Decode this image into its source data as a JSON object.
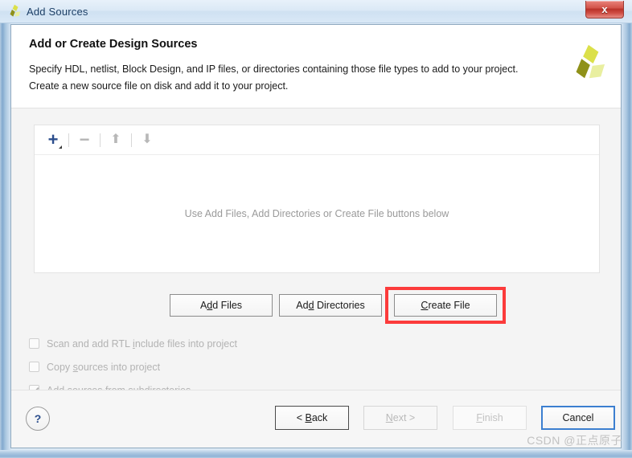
{
  "window": {
    "title": "Add Sources",
    "app_icon": "xilinx-logo-icon",
    "close_label": "x"
  },
  "header": {
    "title": "Add or Create Design Sources",
    "line1": "Specify HDL, netlist, Block Design, and IP files, or directories containing those file types to add to your project.",
    "line2": "Create a new source file on disk and add it to your project.",
    "logo": "xilinx-logo-icon"
  },
  "list_panel": {
    "toolbar": {
      "add_icon": "plus-icon",
      "remove_icon": "minus-icon",
      "move_up_icon": "arrow-up-icon",
      "move_down_icon": "arrow-down-icon",
      "add_glyph": "+",
      "remove_glyph": "−",
      "up_glyph": "⬆",
      "down_glyph": "⬇"
    },
    "empty_message": "Use Add Files, Add Directories or Create File buttons below"
  },
  "actions": {
    "add_files": {
      "pre": "A",
      "mnemonic": "d",
      "post": "d Files"
    },
    "add_directories": {
      "pre": "Ad",
      "mnemonic": "d",
      "post": " Directories"
    },
    "create_file": {
      "pre": "",
      "mnemonic": "C",
      "post": "reate File"
    },
    "highlight_color": "#fc3b3b",
    "highlighted": "create_file"
  },
  "options": [
    {
      "pre": "Scan and add RTL ",
      "mnemonic": "i",
      "post": "nclude files into project",
      "checked": false,
      "enabled": false
    },
    {
      "pre": "Copy ",
      "mnemonic": "s",
      "post": "ources into project",
      "checked": false,
      "enabled": false
    },
    {
      "pre": "Add so",
      "mnemonic": "u",
      "post": "rces from subdirectories",
      "checked": true,
      "enabled": false
    }
  ],
  "footer": {
    "help_glyph": "?",
    "back": {
      "pre": "< ",
      "mnemonic": "B",
      "post": "ack",
      "enabled": true
    },
    "next": {
      "pre": "",
      "mnemonic": "N",
      "post": "ext >",
      "enabled": false
    },
    "finish": {
      "pre": "",
      "mnemonic": "F",
      "post": "inish",
      "enabled": false
    },
    "cancel": {
      "pre": "Cancel",
      "mnemonic": "",
      "post": "",
      "enabled": true,
      "focused": true
    }
  },
  "watermark": "CSDN @正点原子"
}
